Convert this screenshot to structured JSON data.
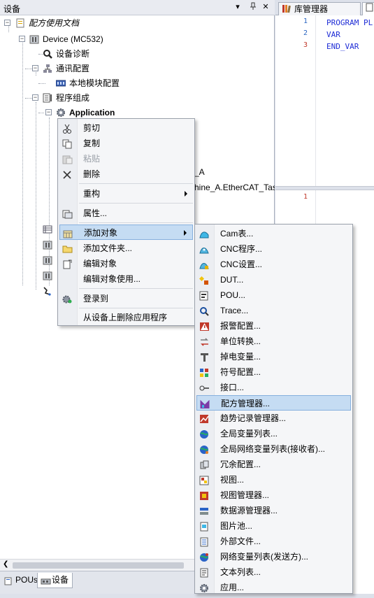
{
  "pane": {
    "title": "设备",
    "buttons": {
      "dropdown": "▾",
      "pin": "ᚬ",
      "close": "✕"
    }
  },
  "tree": {
    "root": "配方使用文档",
    "device": "Device (MC532)",
    "diag": "设备诊断",
    "comm": "通讯配置",
    "local_module": "本地模块配置",
    "program": "程序组成",
    "application": "Application",
    "partial_item_1": "_A",
    "partial_item_2": "hine_A.EtherCAT_Task"
  },
  "bottom_tabs": {
    "pous": "POUs",
    "devices": "设备"
  },
  "editor": {
    "tabs": {
      "library": "库管理器"
    },
    "lines": [
      {
        "num": "1",
        "text": "PROGRAM PL"
      },
      {
        "num": "2",
        "text": "VAR"
      },
      {
        "num": "3",
        "text": "END_VAR"
      }
    ],
    "lower_line": "1"
  },
  "context_menu": {
    "cut": "剪切",
    "copy": "复制",
    "paste": "粘贴",
    "delete": "删除",
    "refactor": "重构",
    "properties": "属性...",
    "add_object": "添加对象",
    "add_folder": "添加文件夹...",
    "edit_object": "编辑对象",
    "edit_object_with": "编辑对象使用...",
    "login": "登录到",
    "remove_app": "从设备上删除应用程序"
  },
  "submenu": [
    {
      "label": "Cam表..."
    },
    {
      "label": "CNC程序..."
    },
    {
      "label": "CNC设置..."
    },
    {
      "label": "DUT..."
    },
    {
      "label": "POU..."
    },
    {
      "label": "Trace..."
    },
    {
      "label": "报警配置..."
    },
    {
      "label": "单位转换..."
    },
    {
      "label": "掉电变量..."
    },
    {
      "label": "符号配置..."
    },
    {
      "label": "接口..."
    },
    {
      "label": "配方管理器..."
    },
    {
      "label": "趋势记录管理器..."
    },
    {
      "label": "全局变量列表..."
    },
    {
      "label": "全局网络变量列表(接收者)..."
    },
    {
      "label": "冗余配置..."
    },
    {
      "label": "视图..."
    },
    {
      "label": "视图管理器..."
    },
    {
      "label": "数据源管理器..."
    },
    {
      "label": "图片池..."
    },
    {
      "label": "外部文件..."
    },
    {
      "label": "网络变量列表(发送方)..."
    },
    {
      "label": "文本列表..."
    },
    {
      "label": "应用..."
    }
  ],
  "colors": {
    "highlight": "#c5dcf3",
    "highlight_border": "#86b0de",
    "keyword": "#1f2dd6"
  }
}
